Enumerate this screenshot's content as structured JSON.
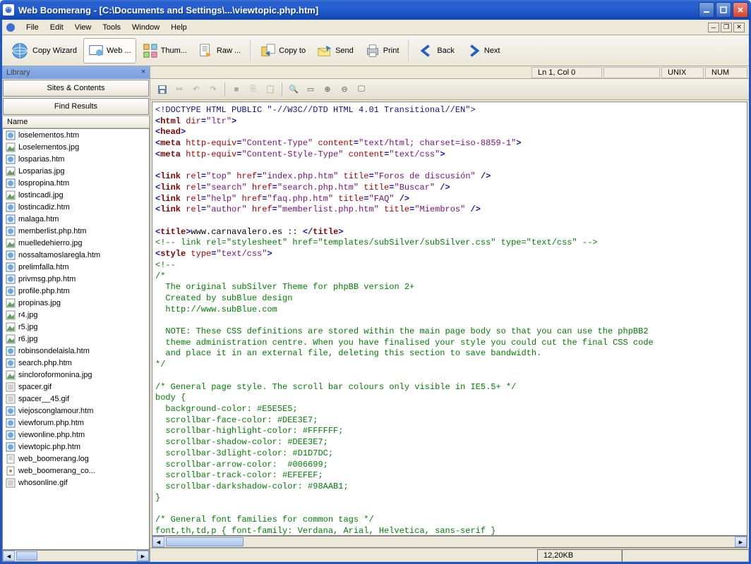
{
  "titlebar": {
    "title": "Web Boomerang - [C:\\Documents and Settings\\...\\viewtopic.php.htm]"
  },
  "menubar": {
    "items": [
      "File",
      "Edit",
      "View",
      "Tools",
      "Window",
      "Help"
    ]
  },
  "toolbar": {
    "copy_wizard": "Copy Wizard",
    "web": "Web ...",
    "thum": "Thum...",
    "raw": "Raw ...",
    "copy_to": "Copy to",
    "send": "Send",
    "print": "Print",
    "back": "Back",
    "next": "Next"
  },
  "left_panel": {
    "title": "Library",
    "tabs": {
      "sites": "Sites & Contents",
      "find": "Find Results"
    },
    "header": "Name",
    "files": [
      {
        "name": "loselementos.htm",
        "type": "htm"
      },
      {
        "name": "Loselementos.jpg",
        "type": "jpg"
      },
      {
        "name": "losparias.htm",
        "type": "htm"
      },
      {
        "name": "Losparias.jpg",
        "type": "jpg"
      },
      {
        "name": "lospropina.htm",
        "type": "htm"
      },
      {
        "name": "lostincadi.jpg",
        "type": "jpg"
      },
      {
        "name": "lostincadiz.htm",
        "type": "htm"
      },
      {
        "name": "malaga.htm",
        "type": "htm"
      },
      {
        "name": "memberlist.php.htm",
        "type": "htm"
      },
      {
        "name": "muelledehierro.jpg",
        "type": "jpg"
      },
      {
        "name": "nossaltamoslaregla.htm",
        "type": "htm"
      },
      {
        "name": "prelimfalla.htm",
        "type": "htm"
      },
      {
        "name": "privmsg.php.htm",
        "type": "htm"
      },
      {
        "name": "profile.php.htm",
        "type": "htm"
      },
      {
        "name": "propinas.jpg",
        "type": "jpg"
      },
      {
        "name": "r4.jpg",
        "type": "jpg"
      },
      {
        "name": "r5.jpg",
        "type": "jpg"
      },
      {
        "name": "r6.jpg",
        "type": "jpg"
      },
      {
        "name": "robinsondelaisla.htm",
        "type": "htm"
      },
      {
        "name": "search.php.htm",
        "type": "htm"
      },
      {
        "name": "sincloroformonina.jpg",
        "type": "jpg"
      },
      {
        "name": "spacer.gif",
        "type": "gif"
      },
      {
        "name": "spacer__45.gif",
        "type": "gif"
      },
      {
        "name": "viejosconglamour.htm",
        "type": "htm"
      },
      {
        "name": "viewforum.php.htm",
        "type": "htm"
      },
      {
        "name": "viewonline.php.htm",
        "type": "htm"
      },
      {
        "name": "viewtopic.php.htm",
        "type": "htm"
      },
      {
        "name": "web_boomerang.log",
        "type": "log"
      },
      {
        "name": "web_boomerang_co...",
        "type": "cfg"
      },
      {
        "name": "whosonline.gif",
        "type": "gif"
      }
    ]
  },
  "status_top": {
    "position": "Ln 1, Col 0",
    "encoding": "UNIX",
    "mode": "NUM"
  },
  "status_bottom": {
    "filesize": "12,20KB"
  },
  "editor": {
    "lines": [
      {
        "t": "doctype",
        "raw": "<!DOCTYPE HTML PUBLIC \"-//W3C//DTD HTML 4.01 Transitional//EN\">"
      },
      {
        "t": "tag",
        "open": "<",
        "name": "html",
        "attrs": [
          {
            "n": "dir",
            "v": "\"ltr\""
          }
        ],
        "close": ">"
      },
      {
        "t": "tag",
        "open": "<",
        "name": "head",
        "attrs": [],
        "close": ">"
      },
      {
        "t": "tag",
        "open": "<",
        "name": "meta",
        "attrs": [
          {
            "n": "http-equiv",
            "v": "\"Content-Type\""
          },
          {
            "n": "content",
            "v": "\"text/html; charset=iso-8859-1\""
          }
        ],
        "close": ">"
      },
      {
        "t": "tag",
        "open": "<",
        "name": "meta",
        "attrs": [
          {
            "n": "http-equiv",
            "v": "\"Content-Style-Type\""
          },
          {
            "n": "content",
            "v": "\"text/css\""
          }
        ],
        "close": ">"
      },
      {
        "t": "blank"
      },
      {
        "t": "tag",
        "open": "<",
        "name": "link",
        "attrs": [
          {
            "n": "rel",
            "v": "\"top\""
          },
          {
            "n": "href",
            "v": "\"index.php.htm\""
          },
          {
            "n": "title",
            "v": "\"Foros de discusión\""
          }
        ],
        "close": " />"
      },
      {
        "t": "tag",
        "open": "<",
        "name": "link",
        "attrs": [
          {
            "n": "rel",
            "v": "\"search\""
          },
          {
            "n": "href",
            "v": "\"search.php.htm\""
          },
          {
            "n": "title",
            "v": "\"Buscar\""
          }
        ],
        "close": " />"
      },
      {
        "t": "tag",
        "open": "<",
        "name": "link",
        "attrs": [
          {
            "n": "rel",
            "v": "\"help\""
          },
          {
            "n": "href",
            "v": "\"faq.php.htm\""
          },
          {
            "n": "title",
            "v": "\"FAQ\""
          }
        ],
        "close": " />"
      },
      {
        "t": "tag",
        "open": "<",
        "name": "link",
        "attrs": [
          {
            "n": "rel",
            "v": "\"author\""
          },
          {
            "n": "href",
            "v": "\"memberlist.php.htm\""
          },
          {
            "n": "title",
            "v": "\"Miembros\""
          }
        ],
        "close": " />"
      },
      {
        "t": "blank"
      },
      {
        "t": "titleline",
        "text": "www.carnavalero.es :: "
      },
      {
        "t": "comment",
        "raw": "<!-- link rel=\"stylesheet\" href=\"templates/subSilver/subSilver.css\" type=\"text/css\" -->"
      },
      {
        "t": "tag",
        "open": "<",
        "name": "style",
        "attrs": [
          {
            "n": "type",
            "v": "\"text/css\""
          }
        ],
        "close": ">"
      },
      {
        "t": "comment",
        "raw": "<!--"
      },
      {
        "t": "comment",
        "raw": "/*"
      },
      {
        "t": "comment",
        "raw": "  The original subSilver Theme for phpBB version 2+"
      },
      {
        "t": "comment",
        "raw": "  Created by subBlue design"
      },
      {
        "t": "comment",
        "raw": "  http://www.subBlue.com"
      },
      {
        "t": "blank"
      },
      {
        "t": "comment",
        "raw": "  NOTE: These CSS definitions are stored within the main page body so that you can use the phpBB2"
      },
      {
        "t": "comment",
        "raw": "  theme administration centre. When you have finalised your style you could cut the final CSS code"
      },
      {
        "t": "comment",
        "raw": "  and place it in an external file, deleting this section to save bandwidth."
      },
      {
        "t": "comment",
        "raw": "*/"
      },
      {
        "t": "blank"
      },
      {
        "t": "comment",
        "raw": "/* General page style. The scroll bar colours only visible in IE5.5+ */"
      },
      {
        "t": "comment",
        "raw": "body {"
      },
      {
        "t": "comment",
        "raw": "  background-color: #E5E5E5;"
      },
      {
        "t": "comment",
        "raw": "  scrollbar-face-color: #DEE3E7;"
      },
      {
        "t": "comment",
        "raw": "  scrollbar-highlight-color: #FFFFFF;"
      },
      {
        "t": "comment",
        "raw": "  scrollbar-shadow-color: #DEE3E7;"
      },
      {
        "t": "comment",
        "raw": "  scrollbar-3dlight-color: #D1D7DC;"
      },
      {
        "t": "comment",
        "raw": "  scrollbar-arrow-color:  #006699;"
      },
      {
        "t": "comment",
        "raw": "  scrollbar-track-color: #EFEFEF;"
      },
      {
        "t": "comment",
        "raw": "  scrollbar-darkshadow-color: #98AAB1;"
      },
      {
        "t": "comment",
        "raw": "}"
      },
      {
        "t": "blank"
      },
      {
        "t": "comment",
        "raw": "/* General font families for common tags */"
      },
      {
        "t": "comment",
        "raw": "font,th,td,p { font-family: Verdana, Arial, Helvetica, sans-serif }"
      }
    ]
  }
}
